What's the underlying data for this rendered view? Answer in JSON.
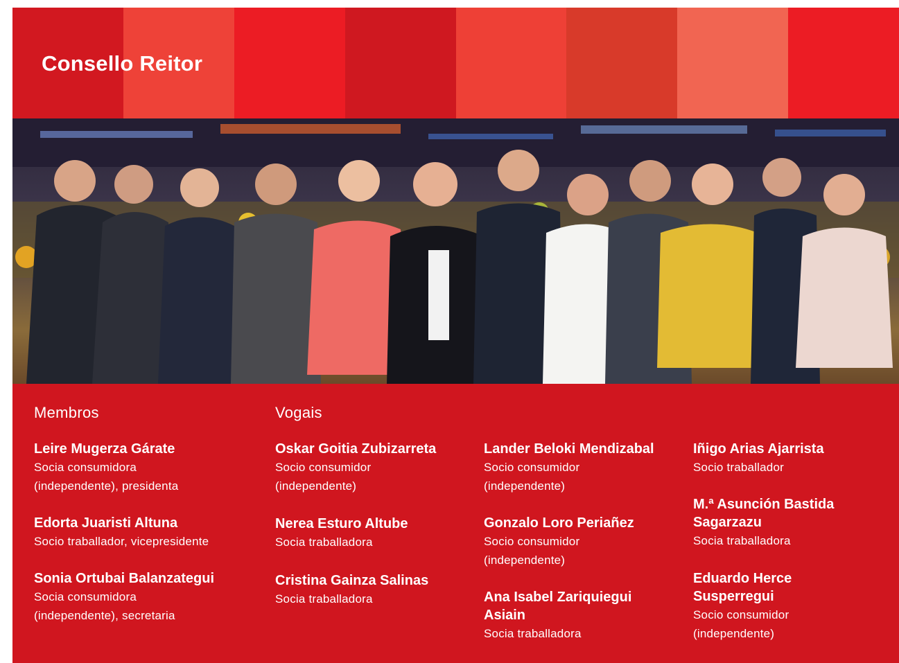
{
  "header": {
    "title": "Consello Reitor",
    "stripe_colors": [
      "#d21820",
      "#ee4238",
      "#ec1c24",
      "#cf1820",
      "#ee4036",
      "#d83a2a",
      "#f16552",
      "#ec1c24"
    ]
  },
  "panel": {
    "background": "#d0161f",
    "membros_heading": "Membros",
    "vogais_heading": "Vogais",
    "members": [
      {
        "name": "Leire Mugerza Gárate",
        "role_lines": [
          "Socia consumidora",
          "(independente), presidenta"
        ]
      },
      {
        "name": "Edorta Juaristi Altuna",
        "role_lines": [
          "Socio traballador, vicepresidente"
        ]
      },
      {
        "name": "Sonia Ortubai Balanzategui",
        "role_lines": [
          "Socia consumidora",
          "(independente), secretaria"
        ]
      }
    ],
    "vogais_col1": [
      {
        "name": "Oskar Goitia Zubizarreta",
        "role_lines": [
          "Socio consumidor",
          "(independente)"
        ]
      },
      {
        "name": "Nerea Esturo Altube",
        "role_lines": [
          "Socia traballadora"
        ]
      },
      {
        "name": "Cristina Gainza Salinas",
        "role_lines": [
          "Socia traballadora"
        ]
      }
    ],
    "vogais_col2": [
      {
        "name": "Lander Beloki Mendizabal",
        "role_lines": [
          "Socio consumidor",
          "(independente)"
        ]
      },
      {
        "name": "Gonzalo Loro Periañez",
        "role_lines": [
          "Socio consumidor",
          "(independente)"
        ]
      },
      {
        "name": "Ana Isabel Zariquiegui",
        "name_line2": "Asiain",
        "role_lines": [
          "Socia traballadora"
        ]
      }
    ],
    "vogais_col3": [
      {
        "name": "Iñigo Arias Ajarrista",
        "role_lines": [
          "Socio traballador"
        ]
      },
      {
        "name": "M.ª Asunción Bastida",
        "name_line2": "Sagarzazu",
        "role_lines": [
          "Socia traballadora"
        ]
      },
      {
        "name": "Eduardo Herce",
        "name_line2": "Susperregui",
        "role_lines": [
          "Socio consumidor",
          "(independente)"
        ]
      }
    ]
  }
}
